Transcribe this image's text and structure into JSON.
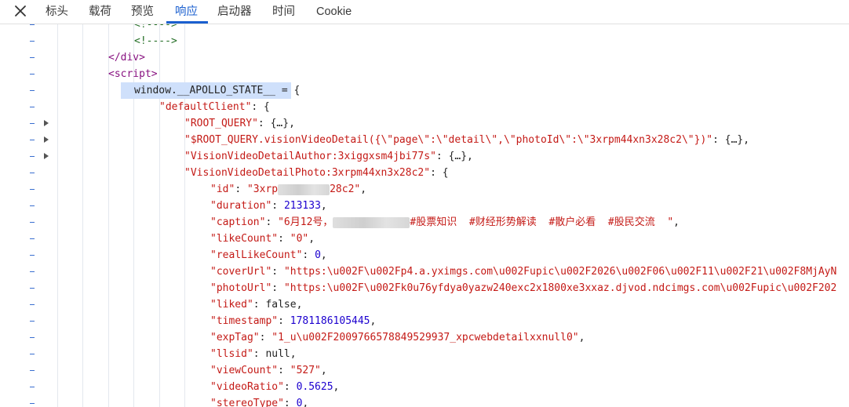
{
  "tabs": [
    {
      "id": "headers",
      "label": "标头"
    },
    {
      "id": "payload",
      "label": "载荷"
    },
    {
      "id": "preview",
      "label": "预览"
    },
    {
      "id": "response",
      "label": "响应"
    },
    {
      "id": "initiator",
      "label": "启动器"
    },
    {
      "id": "timing",
      "label": "时间"
    },
    {
      "id": "cookie",
      "label": "Cookie"
    }
  ],
  "active_tab": "响应",
  "colors": {
    "accent": "#1a5fcf",
    "string": "#c41a16",
    "number": "#1c00cf",
    "tag": "#881280",
    "selection": "#cfe0fb"
  },
  "code": {
    "comment1": "<!---->",
    "comment2": "<!---->",
    "div_close": "</div>",
    "script_open": "<script>",
    "window_line": "window.__APOLLO_STATE__ = {",
    "default_client_key": "\"defaultClient\"",
    "root_query_key": "\"ROOT_QUERY\"",
    "vision_detail_key": "\"$ROOT_QUERY.visionVideoDetail({\\\"page\\\":\\\"detail\\\",\\\"photoId\\\":\\\"3xrpm44xn3x28c2\\\"})\"",
    "author_key": "\"VisionVideoDetailAuthor:3xiggxsm4jbi77s\"",
    "photo_key": "\"VisionVideoDetailPhoto:3xrpm44xn3x28c2\"",
    "collapsed": "{…}",
    "id_key": "\"id\"",
    "id_value_start": "\"3xrp",
    "id_value_end": "28c2\"",
    "duration_key": "\"duration\"",
    "duration_value": "213133",
    "caption_key": "\"caption\"",
    "caption_value_start": "\"6月12号，",
    "caption_value_end": "#股票知识  #财经形势解读  #散户必看  #股民交流  \"",
    "likecount_key": "\"likeCount\"",
    "likecount_value": "\"0\"",
    "reallikecount_key": "\"realLikeCount\"",
    "reallikecount_value": "0",
    "coverurl_key": "\"coverUrl\"",
    "coverurl_value": "\"https:\\u002F\\u002Fp4.a.yximgs.com\\u002Fupic\\u002F2026\\u002F06\\u002F11\\u002F21\\u002F8MjAyN",
    "photourl_key": "\"photoUrl\"",
    "photourl_value": "\"https:\\u002F\\u002Fk0u76yfdya0yazw240exc2x1800xe3xxaz.djvod.ndcimgs.com\\u002Fupic\\u002F202",
    "liked_key": "\"liked\"",
    "liked_value": "false",
    "timestamp_key": "\"timestamp\"",
    "timestamp_value": "1781186105445",
    "exptag_key": "\"expTag\"",
    "exptag_value": "\"1_u\\u002F2009766578849529937_xpcwebdetailxxnull0\"",
    "llsid_key": "\"llsid\"",
    "llsid_value": "null",
    "viewcount_key": "\"viewCount\"",
    "viewcount_value": "\"527\"",
    "videoratio_key": "\"videoRatio\"",
    "videoratio_value": "0.5625",
    "stereotype_key": "\"stereoType\"",
    "stereotype_value": "0"
  }
}
